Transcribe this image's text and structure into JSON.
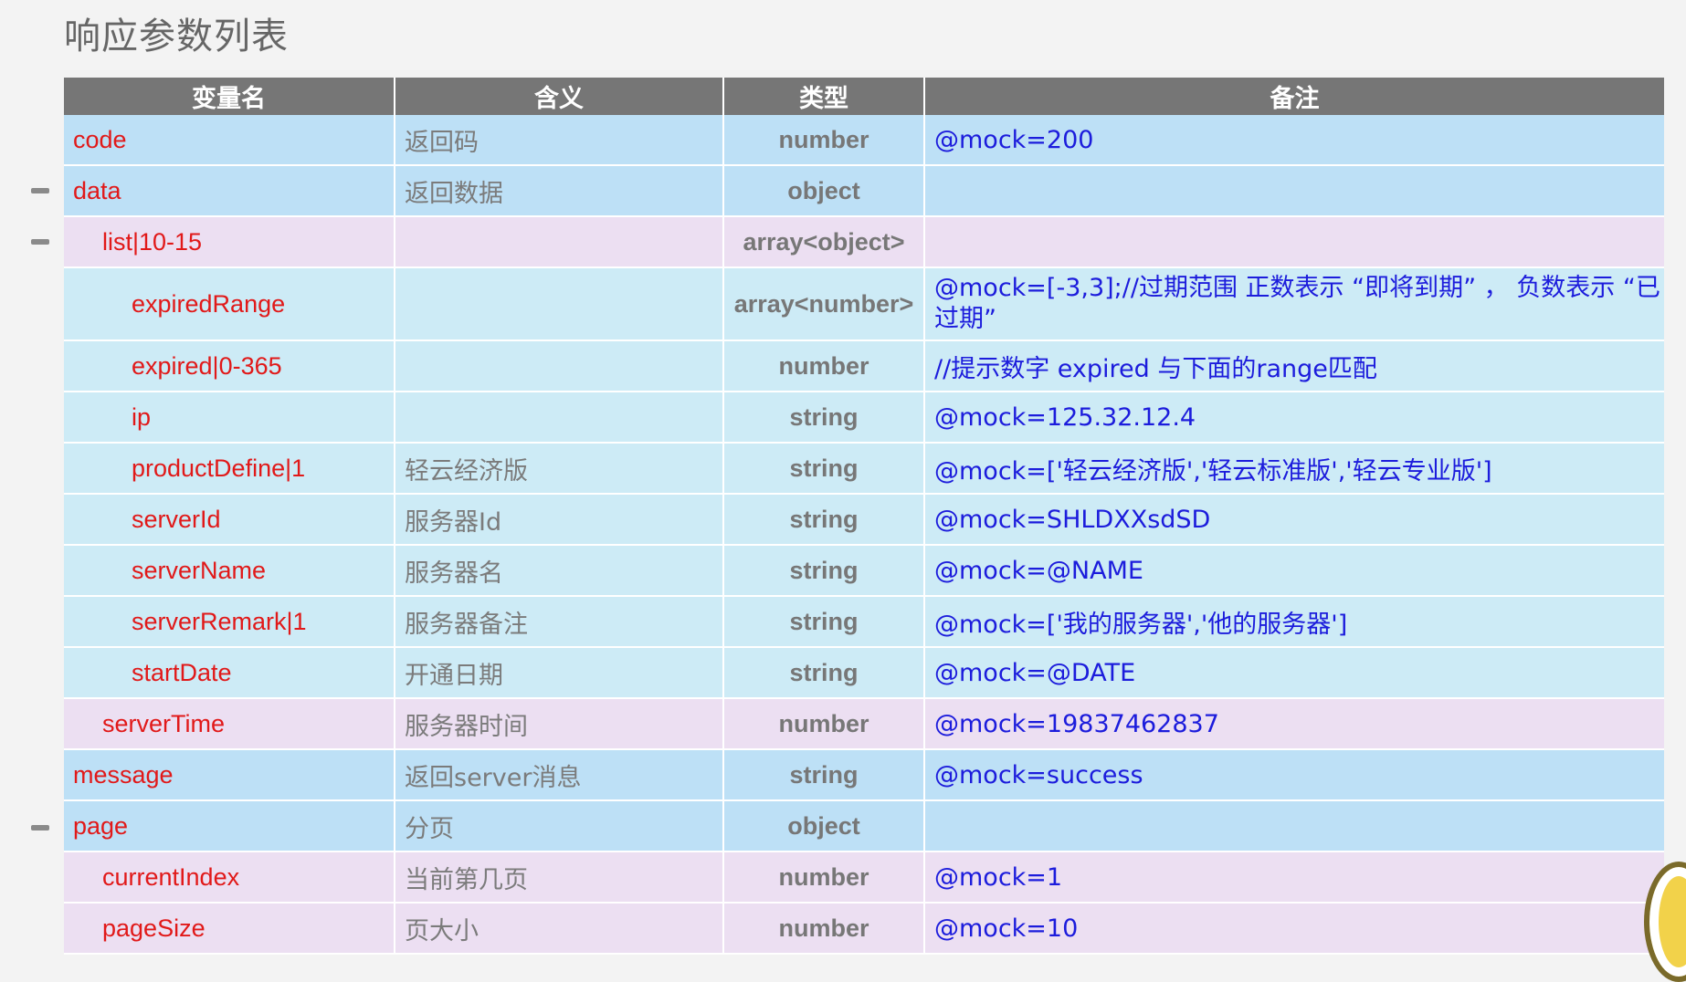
{
  "title": "响应参数列表",
  "columns": [
    "变量名",
    "含义",
    "类型",
    "备注"
  ],
  "rows": [
    {
      "name": "code",
      "meaning": "返回码",
      "type": "number",
      "note": "@mock=200"
    },
    {
      "name": "data",
      "meaning": "返回数据",
      "type": "object",
      "note": ""
    },
    {
      "name": "list|10-15",
      "meaning": "",
      "type": "array<object>",
      "note": ""
    },
    {
      "name": "expiredRange",
      "meaning": "",
      "type": "array<number>",
      "note": "@mock=[-3,3];//过期范围 正数表示 “即将到期” ，  负数表示 “已过期”"
    },
    {
      "name": "expired|0-365",
      "meaning": "",
      "type": "number",
      "note": "//提示数字 expired 与下面的range匹配"
    },
    {
      "name": "ip",
      "meaning": "",
      "type": "string",
      "note": "@mock=125.32.12.4"
    },
    {
      "name": "productDefine|1",
      "meaning": "轻云经济版",
      "type": "string",
      "note": "@mock=['轻云经济版','轻云标准版','轻云专业版']"
    },
    {
      "name": "serverId",
      "meaning": "服务器Id",
      "type": "string",
      "note": "@mock=SHLDXXsdSD"
    },
    {
      "name": "serverName",
      "meaning": "服务器名",
      "type": "string",
      "note": "@mock=@NAME"
    },
    {
      "name": "serverRemark|1",
      "meaning": "服务器备注",
      "type": "string",
      "note": "@mock=['我的服务器','他的服务器']"
    },
    {
      "name": "startDate",
      "meaning": "开通日期",
      "type": "string",
      "note": "@mock=@DATE"
    },
    {
      "name": "serverTime",
      "meaning": "服务器时间",
      "type": "number",
      "note": "@mock=19837462837"
    },
    {
      "name": "message",
      "meaning": "返回server消息",
      "type": "string",
      "note": "@mock=success"
    },
    {
      "name": "page",
      "meaning": "分页",
      "type": "object",
      "note": ""
    },
    {
      "name": "currentIndex",
      "meaning": "当前第几页",
      "type": "number",
      "note": "@mock=1"
    },
    {
      "name": "pageSize",
      "meaning": "页大小",
      "type": "number",
      "note": "@mock=10"
    }
  ]
}
